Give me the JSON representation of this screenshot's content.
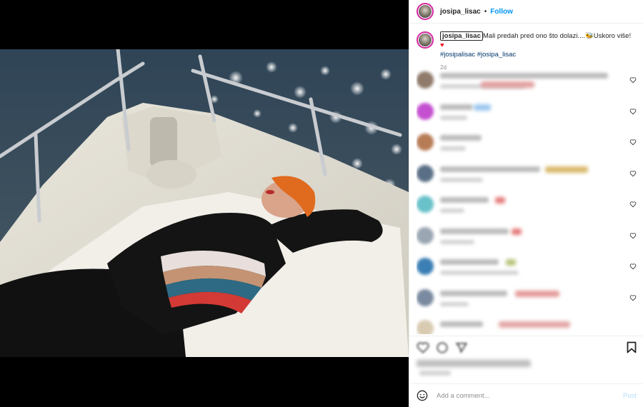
{
  "post": {
    "username": "josipa_lisac",
    "dot": "•",
    "follow_label": "Follow"
  },
  "caption": {
    "username": "josipa_lisac",
    "text_a": "Mali predah pred ono što dolazi....",
    "bee_emoji": "🐝",
    "text_b": "Uskoro više! ",
    "heart_emoji": "♥",
    "hashtags": "#josipalisac #josipa_lisac",
    "time": "2d"
  },
  "comments": {
    "count_visible": 9,
    "note_state": "blurred"
  },
  "composer": {
    "placeholder": "Add a comment...",
    "post_label": "Post"
  },
  "icons": {
    "like": "heart-outline-icon",
    "comment": "comment-icon",
    "share": "share-icon",
    "save": "bookmark-icon",
    "emoji": "emoji-smile-icon"
  },
  "colors": {
    "link_blue": "#0095f6",
    "hashtag_blue": "#00376b",
    "post_disabled": "#b2dffc",
    "avatar_ring": "#d6249f"
  }
}
